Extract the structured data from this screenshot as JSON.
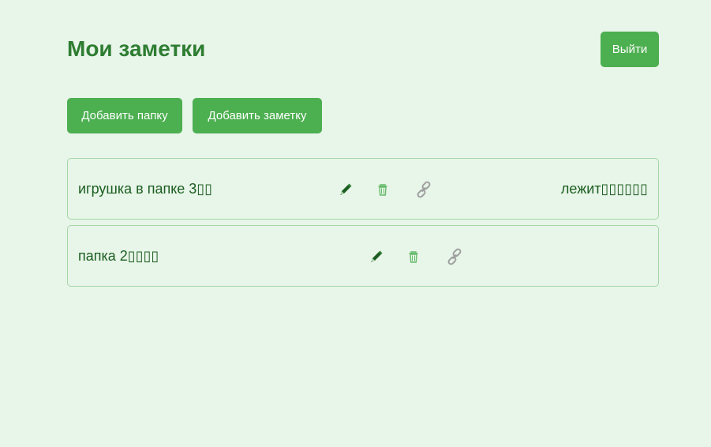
{
  "header": {
    "title": "Мои заметки",
    "logout_label": "Выйти"
  },
  "toolbar": {
    "add_folder_label": "Добавить папку",
    "add_note_label": "Добавить заметку"
  },
  "items": [
    {
      "title": "игрушка в папке 3▯▯",
      "note": "лежит▯▯▯▯▯▯"
    },
    {
      "title": "папка 2▯▯▯▯"
    }
  ],
  "icons": {
    "edit": "pencil-icon",
    "delete": "trash-icon",
    "share": "link-icon"
  },
  "colors": {
    "background": "#e8f5e9",
    "accent": "#4caf50",
    "title": "#2e7d32",
    "text": "#1b5e20",
    "border": "#a5d6a7"
  }
}
